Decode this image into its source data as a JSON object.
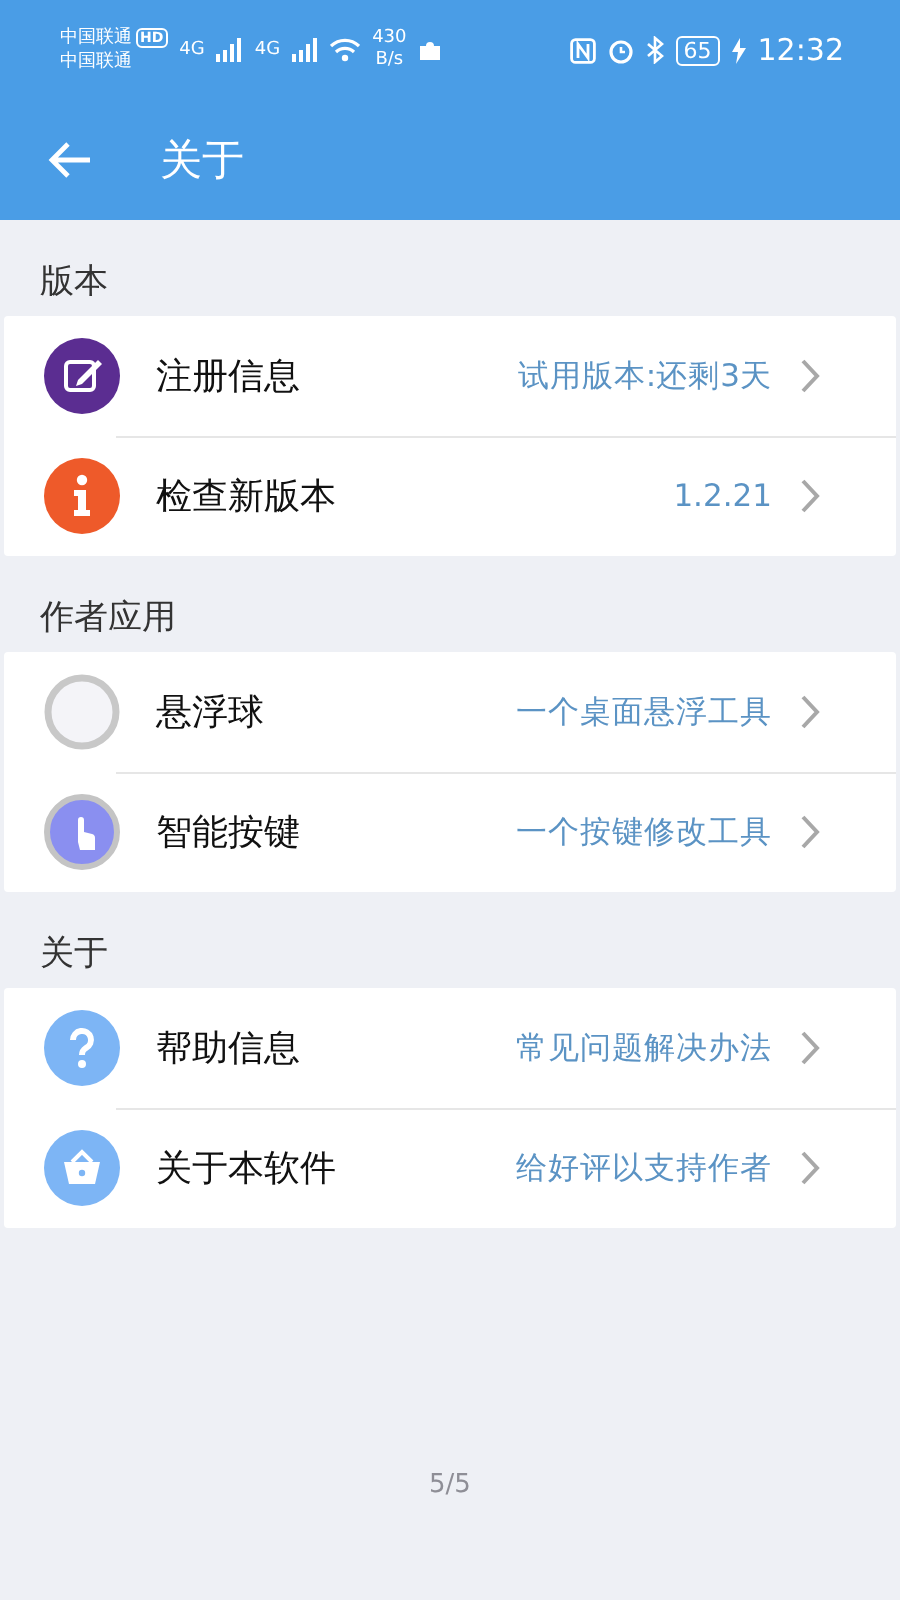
{
  "status_bar": {
    "carrier_1": "中国联通",
    "hd_badge": "HD",
    "carrier_2": "中国联通",
    "network_1": "4G",
    "network_2": "4G",
    "speed_value": "430",
    "speed_unit": "B/s",
    "battery": "65",
    "time": "12:32"
  },
  "app_bar": {
    "title": "关于"
  },
  "sections": [
    {
      "title": "版本",
      "items": [
        {
          "kind": "edit",
          "color": "#5b2d91",
          "label": "注册信息",
          "value": "试用版本:还剩3天"
        },
        {
          "kind": "info",
          "color": "#ee5a2a",
          "label": "检查新版本",
          "value": "1.2.21"
        }
      ]
    },
    {
      "title": "作者应用",
      "items": [
        {
          "kind": "ring",
          "color": "#c8c8c8",
          "label": "悬浮球",
          "value": "一个桌面悬浮工具"
        },
        {
          "kind": "touch",
          "color": "#8a8ff0",
          "label": "智能按键",
          "value": "一个按键修改工具"
        }
      ]
    },
    {
      "title": "关于",
      "items": [
        {
          "kind": "help",
          "color": "#7db5f5",
          "label": "帮助信息",
          "value": "常见问题解决办法"
        },
        {
          "kind": "basket",
          "color": "#7db5f5",
          "label": "关于本软件",
          "value": "给好评以支持作者"
        }
      ]
    }
  ],
  "page_indicator": "5/5"
}
